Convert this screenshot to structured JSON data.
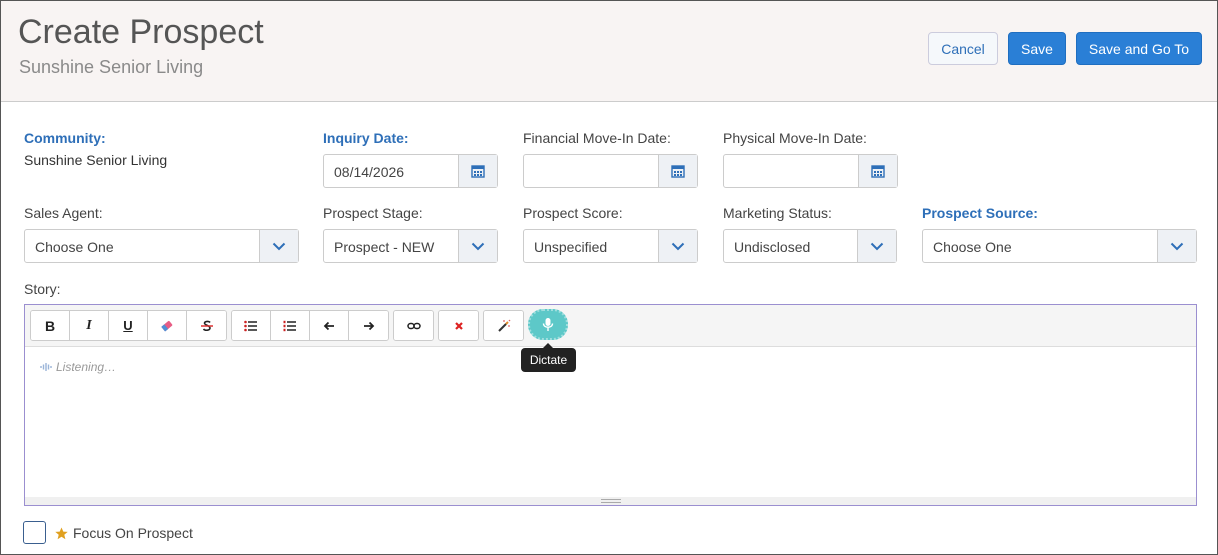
{
  "header": {
    "title": "Create Prospect",
    "subtitle": "Sunshine Senior Living",
    "cancel_label": "Cancel",
    "save_label": "Save",
    "save_go_label": "Save and Go To"
  },
  "form": {
    "community": {
      "label": "Community:",
      "value": "Sunshine Senior Living"
    },
    "inquiry_date": {
      "label": "Inquiry Date:",
      "value": "08/14/2026"
    },
    "financial_move_in": {
      "label": "Financial Move-In Date:",
      "value": ""
    },
    "physical_move_in": {
      "label": "Physical Move-In Date:",
      "value": ""
    },
    "sales_agent": {
      "label": "Sales Agent:",
      "value": "Choose One"
    },
    "prospect_stage": {
      "label": "Prospect Stage:",
      "value": "Prospect - NEW"
    },
    "prospect_score": {
      "label": "Prospect Score:",
      "value": "Unspecified"
    },
    "marketing_status": {
      "label": "Marketing Status:",
      "value": "Undisclosed"
    },
    "prospect_source": {
      "label": "Prospect Source:",
      "value": "Choose One"
    },
    "story": {
      "label": "Story:",
      "listening_text": "Listening…"
    }
  },
  "toolbar": {
    "bold": "B",
    "italic": "I",
    "underline": "U",
    "dictate_tooltip": "Dictate"
  },
  "focus": {
    "label": "Focus On Prospect",
    "checked": false
  },
  "colors": {
    "accent": "#2a7fd6",
    "label_required": "#2e6fb8",
    "mic": "#5dc8c8",
    "star": "#e0a020"
  }
}
